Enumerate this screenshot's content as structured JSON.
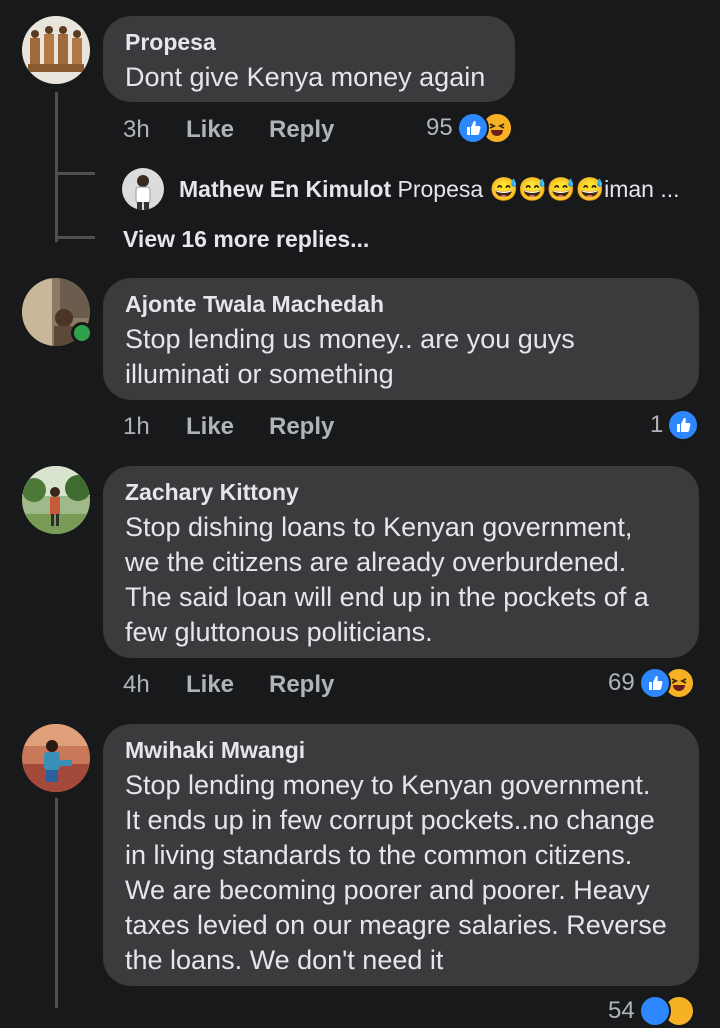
{
  "comments": [
    {
      "author": "Propesa",
      "text": "Dont give Kenya money again",
      "time": "3h",
      "like_label": "Like",
      "reply_label": "Reply",
      "reaction_count": "95",
      "reactions": [
        "like",
        "haha"
      ]
    },
    {
      "author": "Ajonte Twala Machedah",
      "text_lines": [
        "Stop lending us money.. are you guys",
        "illuminati or something"
      ],
      "time": "1h",
      "like_label": "Like",
      "reply_label": "Reply",
      "reaction_count": "1",
      "reactions": [
        "like"
      ]
    },
    {
      "author": "Zachary Kittony",
      "text_lines": [
        "Stop dishing loans to Kenyan government,",
        "we the citizens are already overburdened.",
        "The said loan will end up in the pockets of a",
        "few gluttonous politicians."
      ],
      "time": "4h",
      "like_label": "Like",
      "reply_label": "Reply",
      "reaction_count": "69",
      "reactions": [
        "like",
        "haha"
      ]
    },
    {
      "author": "Mwihaki Mwangi",
      "text_lines": [
        "Stop lending money to Kenyan government.",
        "It ends up in few corrupt pockets..no change",
        "in living standards to the common citizens.",
        "We are becoming poorer and poorer. Heavy",
        "taxes levied on our meagre salaries. Reverse",
        "the loans. We don't need it"
      ],
      "reaction_count": "54",
      "reactions": [
        "like",
        "haha"
      ]
    }
  ],
  "reply": {
    "author": "Mathew En Kimulot",
    "preview": "Propesa 😅😅😅😅iman ..."
  },
  "view_more": "View 16 more replies...",
  "colors": {
    "background": "#18191a",
    "bubble": "#3a3b3c",
    "text": "#e4e6eb",
    "muted": "#b0b3b8",
    "like_blue": "#2d88ff",
    "haha_yellow": "#f7b125",
    "online_green": "#31a24c"
  }
}
